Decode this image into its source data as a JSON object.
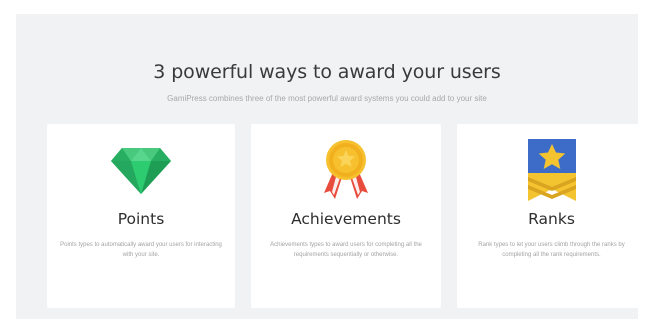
{
  "section": {
    "title": "3 powerful ways to award your users",
    "subtitle": "GamiPress combines three of the most powerful award systems you could add to your site"
  },
  "cards": [
    {
      "icon": "gem-icon",
      "title": "Points",
      "description": "Points types to automatically award your users for interacting with your site."
    },
    {
      "icon": "medal-icon",
      "title": "Achievements",
      "description": "Achievements types to award users for completing all the requirements sequentially or otherwise."
    },
    {
      "icon": "rank-badge-icon",
      "title": "Ranks",
      "description": "Rank types to let your users climb through the ranks by completing all the rank requirements."
    }
  ],
  "colors": {
    "section_background": "#f1f2f4",
    "card_background": "#ffffff",
    "gem_green": "#2ecc71",
    "medal_gold": "#f6c02e",
    "ribbon_red": "#e74c3c",
    "rank_blue": "#3d6cc8",
    "rank_gold": "#f4c430"
  }
}
